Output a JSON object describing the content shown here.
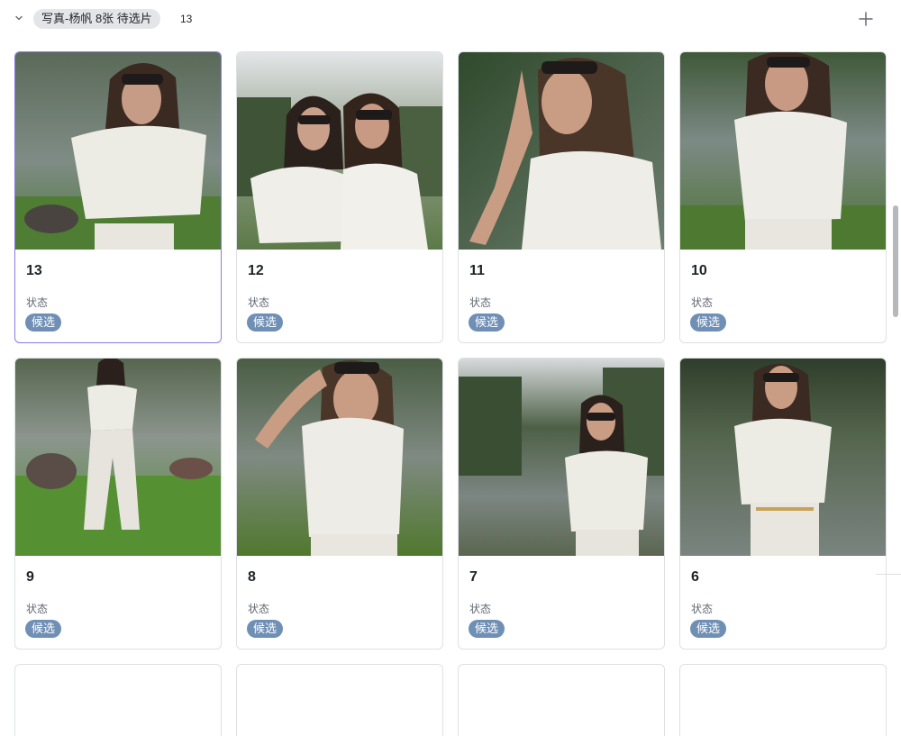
{
  "group": {
    "name": "写真-杨帆 8张 待选片",
    "count": "13"
  },
  "field_label": "状态",
  "cards": [
    {
      "title": "13",
      "status": "候选"
    },
    {
      "title": "12",
      "status": "候选"
    },
    {
      "title": "11",
      "status": "候选"
    },
    {
      "title": "10",
      "status": "候选"
    },
    {
      "title": "9",
      "status": "候选"
    },
    {
      "title": "8",
      "status": "候选"
    },
    {
      "title": "7",
      "status": "候选"
    },
    {
      "title": "6",
      "status": "候选"
    }
  ],
  "colors": {
    "tag_bg": "#6f8fb5",
    "selected_border": "#8a7ae8",
    "card_border": "#dee0e3"
  }
}
